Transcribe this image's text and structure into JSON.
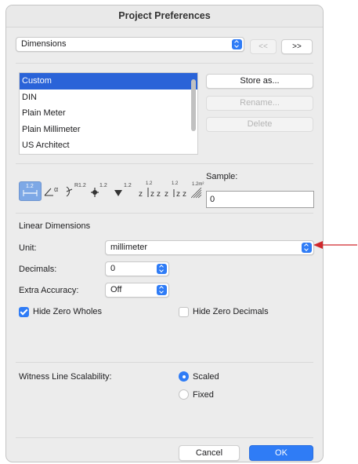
{
  "dialog": {
    "title": "Project Preferences"
  },
  "category": {
    "value": "Dimensions",
    "prev_label": "<<",
    "next_label": ">>"
  },
  "standards": {
    "items": [
      "Custom",
      "DIN",
      "Plain Meter",
      "Plain Millimeter",
      "US Architect"
    ],
    "selected": "Custom"
  },
  "buttons": {
    "store": "Store as...",
    "rename": "Rename...",
    "delete": "Delete",
    "cancel": "Cancel",
    "ok": "OK"
  },
  "toolbar": {
    "icons": [
      "linear-dimension-icon",
      "angular-dimension-icon",
      "radial-dimension-icon",
      "level-dimension-icon",
      "elevation-dimension-icon",
      "door-window-dimension-icon",
      "sill-height-dimension-icon",
      "area-dimension-icon"
    ],
    "labels": {
      "linear": "1.2",
      "angular": "α",
      "radial": "R1.2",
      "level": "1.2",
      "elevation": "1.2",
      "door": "1.2",
      "sill": "1.2",
      "area": "1.2m²"
    }
  },
  "sample": {
    "label": "Sample:",
    "value": "0"
  },
  "linear": {
    "section_title": "Linear Dimensions",
    "unit_label": "Unit:",
    "unit_value": "millimeter",
    "decimals_label": "Decimals:",
    "decimals_value": "0",
    "accuracy_label": "Extra Accuracy:",
    "accuracy_value": "Off",
    "hide_wholes_label": "Hide Zero Wholes",
    "hide_wholes_checked": true,
    "hide_decimals_label": "Hide Zero Decimals",
    "hide_decimals_checked": false
  },
  "witness": {
    "label": "Witness Line Scalability:",
    "scaled": "Scaled",
    "fixed": "Fixed",
    "selected": "Scaled"
  },
  "colors": {
    "accent": "#2f7cf6",
    "annotation_arrow": "#d0282c"
  }
}
